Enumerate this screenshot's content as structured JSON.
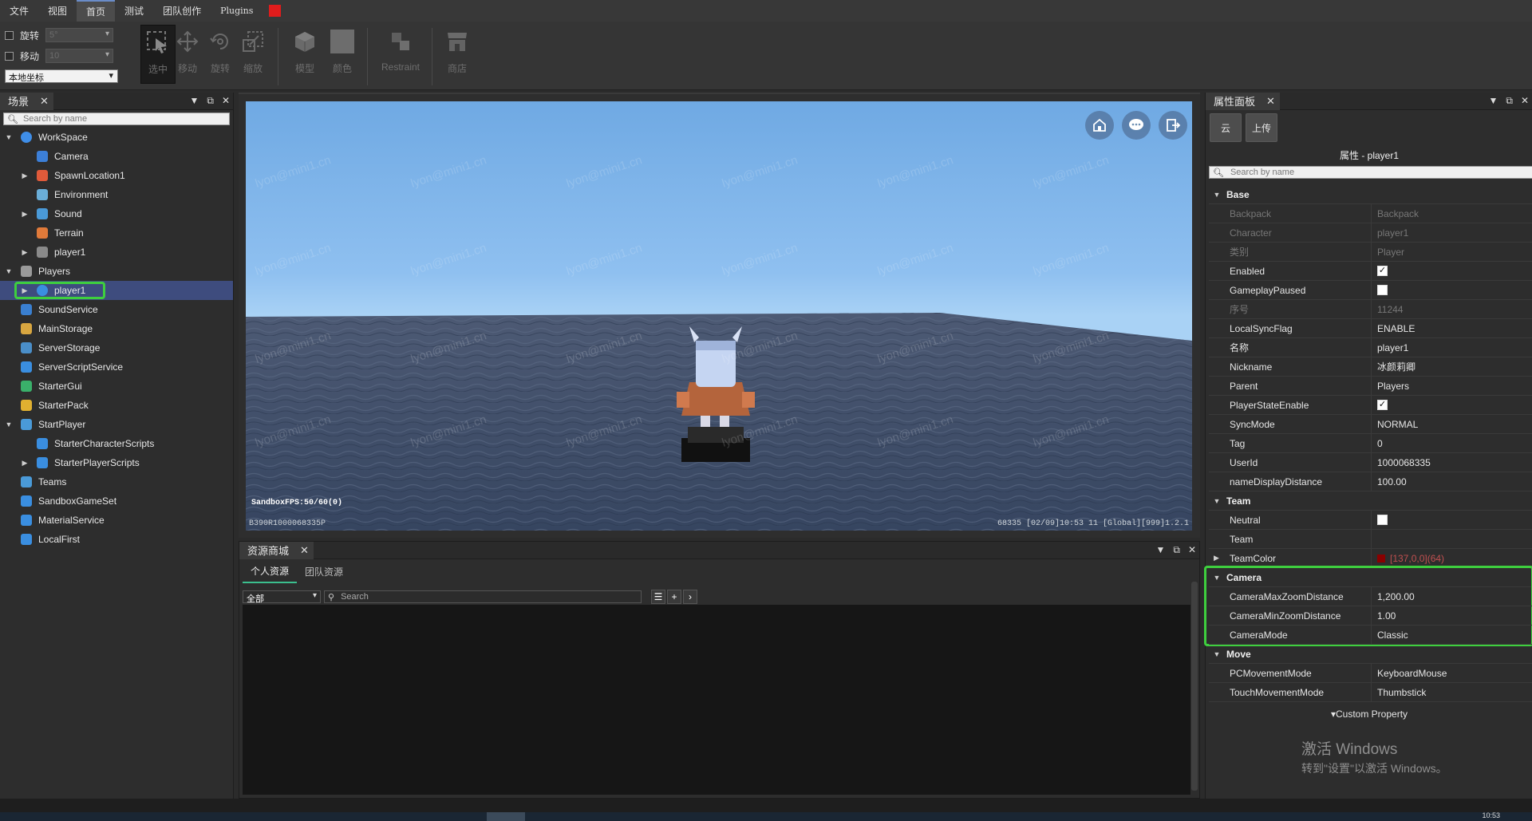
{
  "menu": {
    "items": [
      "文件",
      "视图",
      "首页",
      "测试",
      "团队创作",
      "Plugins"
    ],
    "active_index": 2
  },
  "toolbar": {
    "rotate_label": "旋转",
    "rotate_value": "5°",
    "move_label": "移动",
    "move_value": "10",
    "coord_select": "本地坐标",
    "tools": {
      "select": "选中",
      "move": "移动",
      "rotate": "旋转",
      "scale": "缩放",
      "model": "模型",
      "color": "颜色",
      "restraint": "Restraint",
      "shop": "商店"
    }
  },
  "scene_panel": {
    "tab": "场景",
    "search_placeholder": "Search by name",
    "tree": [
      {
        "label": "WorkSpace",
        "icon": "globe-icon",
        "depth": 0,
        "arrow": "expanded"
      },
      {
        "label": "Camera",
        "icon": "camera-icon",
        "depth": 1,
        "arrow": ""
      },
      {
        "label": "SpawnLocation1",
        "icon": "spawn-icon",
        "depth": 1,
        "arrow": "collapsed"
      },
      {
        "label": "Environment",
        "icon": "environment-icon",
        "depth": 1,
        "arrow": ""
      },
      {
        "label": "Sound",
        "icon": "sound-icon",
        "depth": 1,
        "arrow": "collapsed"
      },
      {
        "label": "Terrain",
        "icon": "terrain-icon",
        "depth": 1,
        "arrow": ""
      },
      {
        "label": "player1",
        "icon": "model-icon",
        "depth": 1,
        "arrow": "collapsed"
      },
      {
        "label": "Players",
        "icon": "players-icon",
        "depth": 0,
        "arrow": "expanded"
      },
      {
        "label": "player1",
        "icon": "player-icon",
        "depth": 1,
        "arrow": "collapsed",
        "selected": true
      },
      {
        "label": "SoundService",
        "icon": "sound-service-icon",
        "depth": 0,
        "arrow": ""
      },
      {
        "label": "MainStorage",
        "icon": "storage-icon",
        "depth": 0,
        "arrow": ""
      },
      {
        "label": "ServerStorage",
        "icon": "server-storage-icon",
        "depth": 0,
        "arrow": ""
      },
      {
        "label": "ServerScriptService",
        "icon": "script-service-icon",
        "depth": 0,
        "arrow": ""
      },
      {
        "label": "StarterGui",
        "icon": "gui-icon",
        "depth": 0,
        "arrow": ""
      },
      {
        "label": "StarterPack",
        "icon": "pack-icon",
        "depth": 0,
        "arrow": ""
      },
      {
        "label": "StartPlayer",
        "icon": "start-player-icon",
        "depth": 0,
        "arrow": "expanded"
      },
      {
        "label": "StarterCharacterScripts",
        "icon": "script-icon",
        "depth": 1,
        "arrow": ""
      },
      {
        "label": "StarterPlayerScripts",
        "icon": "script-icon",
        "depth": 1,
        "arrow": "collapsed"
      },
      {
        "label": "Teams",
        "icon": "teams-icon",
        "depth": 0,
        "arrow": ""
      },
      {
        "label": "SandboxGameSet",
        "icon": "gameset-icon",
        "depth": 0,
        "arrow": ""
      },
      {
        "label": "MaterialService",
        "icon": "material-icon",
        "depth": 0,
        "arrow": ""
      },
      {
        "label": "LocalFirst",
        "icon": "local-icon",
        "depth": 0,
        "arrow": ""
      }
    ]
  },
  "viewport": {
    "watermark": "lyon@mini1.cn",
    "fps": "SandboxFPS:50/60(0)",
    "footer_left": "B390R1000068335P",
    "footer_right": "68335  [02/09]10:53 11  [Global][999]1.2.1"
  },
  "asset_panel": {
    "tab": "资源商城",
    "tabs": [
      "个人资源",
      "团队资源"
    ],
    "filter_select": "全部",
    "search_placeholder": "Search"
  },
  "prop_panel": {
    "tab": "属性面板",
    "buttons": [
      "云",
      "上传"
    ],
    "title": "属性 - player1",
    "search_placeholder": "Search by name",
    "rows": [
      {
        "type": "group",
        "name": "Base"
      },
      {
        "name": "Backpack",
        "value": "Backpack",
        "disabled": true
      },
      {
        "name": "Character",
        "value": "player1",
        "disabled": true
      },
      {
        "name": "类别",
        "value": "Player",
        "disabled": true
      },
      {
        "name": "Enabled",
        "checkbox": true,
        "checked": true
      },
      {
        "name": "GameplayPaused",
        "checkbox": true,
        "checked": false
      },
      {
        "name": "序号",
        "value": "11244",
        "disabled": true
      },
      {
        "name": "LocalSyncFlag",
        "value": "ENABLE"
      },
      {
        "name": "名称",
        "value": "player1"
      },
      {
        "name": "Nickname",
        "value": "冰颜莉卿"
      },
      {
        "name": "Parent",
        "value": "Players"
      },
      {
        "name": "PlayerStateEnable",
        "checkbox": true,
        "checked": true
      },
      {
        "name": "SyncMode",
        "value": "NORMAL"
      },
      {
        "name": "Tag",
        "value": "0"
      },
      {
        "name": "UserId",
        "value": "1000068335"
      },
      {
        "name": "nameDisplayDistance",
        "value": "100.00"
      },
      {
        "type": "group",
        "name": "Team"
      },
      {
        "name": "Neutral",
        "checkbox": true,
        "checked": false
      },
      {
        "name": "Team",
        "value": ""
      },
      {
        "name": "TeamColor",
        "value": "[137,0,0](64)",
        "swatch": "#890000",
        "expander": true
      },
      {
        "type": "group",
        "name": "Camera"
      },
      {
        "name": "CameraMaxZoomDistance",
        "value": "1,200.00"
      },
      {
        "name": "CameraMinZoomDistance",
        "value": "1.00"
      },
      {
        "name": "CameraMode",
        "value": "Classic"
      },
      {
        "type": "group",
        "name": "Move"
      },
      {
        "name": "PCMovementMode",
        "value": "KeyboardMouse"
      },
      {
        "name": "TouchMovementMode",
        "value": "Thumbstick"
      }
    ],
    "custom_property": "▾Custom Property",
    "activate_line1": "激活 Windows",
    "activate_line2": "转到\"设置\"以激活 Windows。"
  },
  "taskbar": {
    "clock": "10:53"
  },
  "colors": {
    "highlight_box": "#3ecf3e",
    "selection": "#3e4c7e",
    "asset_tab_underline": "#3bbf8e",
    "record": "#e01c1c"
  }
}
